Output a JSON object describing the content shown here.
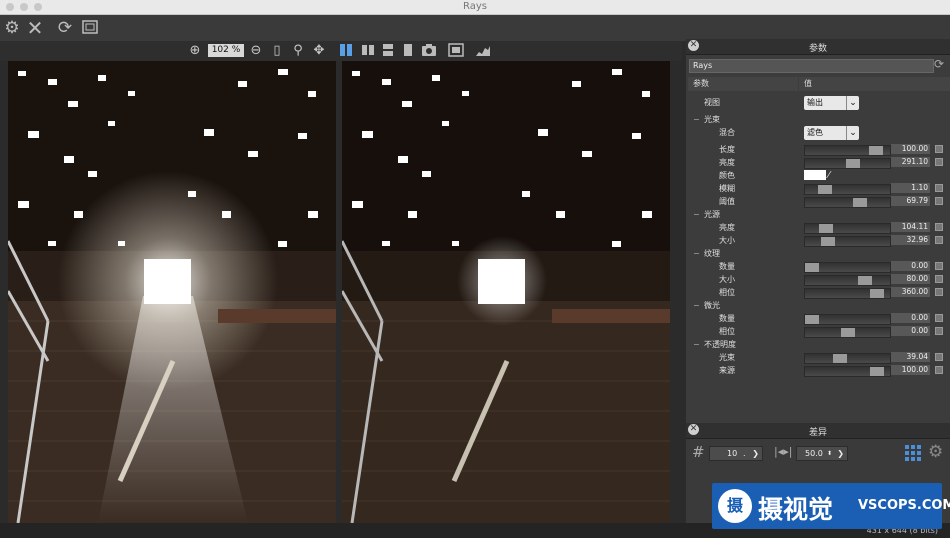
{
  "window": {
    "title": "Rays"
  },
  "toolbar": {
    "icons": [
      "gear-icon",
      "close-icon",
      "refresh-icon",
      "crop-icon"
    ]
  },
  "viewbar": {
    "zoom": "102 %"
  },
  "panel": {
    "title": "参数",
    "preset": "Rays",
    "col_param": "参数",
    "col_value": "值",
    "rows": [
      {
        "label": "视图",
        "level": 1,
        "type": "dropdown",
        "value": "输出"
      },
      {
        "label": "光束",
        "level": 0,
        "type": "group",
        "toggle": "−"
      },
      {
        "label": "混合",
        "level": 2,
        "type": "dropdown",
        "value": "滤色"
      },
      {
        "label": "长度",
        "level": 2,
        "type": "slider",
        "value": "100.00",
        "fraction": 0.9
      },
      {
        "label": "亮度",
        "level": 2,
        "type": "slider",
        "value": "291.10",
        "fraction": 0.58
      },
      {
        "label": "颜色",
        "level": 2,
        "type": "color",
        "value": "#ffffff"
      },
      {
        "label": "模糊",
        "level": 2,
        "type": "slider",
        "value": "1.10",
        "fraction": 0.18
      },
      {
        "label": "阈值",
        "level": 2,
        "type": "slider",
        "value": "69.79",
        "fraction": 0.68
      },
      {
        "label": "光源",
        "level": 0,
        "type": "group",
        "toggle": "−"
      },
      {
        "label": "亮度",
        "level": 2,
        "type": "slider",
        "value": "104.11",
        "fraction": 0.2
      },
      {
        "label": "大小",
        "level": 2,
        "type": "slider",
        "value": "32.96",
        "fraction": 0.22
      },
      {
        "label": "纹理",
        "level": 0,
        "type": "group",
        "toggle": "−"
      },
      {
        "label": "数量",
        "level": 2,
        "type": "slider",
        "value": "0.00",
        "fraction": 0.0
      },
      {
        "label": "大小",
        "level": 2,
        "type": "slider",
        "value": "80.00",
        "fraction": 0.75
      },
      {
        "label": "相位",
        "level": 2,
        "type": "slider",
        "value": "360.00",
        "fraction": 0.92
      },
      {
        "label": "微光",
        "level": 0,
        "type": "group",
        "toggle": "−"
      },
      {
        "label": "数量",
        "level": 2,
        "type": "slider",
        "value": "0.00",
        "fraction": 0.0
      },
      {
        "label": "相位",
        "level": 2,
        "type": "slider",
        "value": "0.00",
        "fraction": 0.5
      },
      {
        "label": "不透明度",
        "level": 0,
        "type": "group",
        "toggle": "−"
      },
      {
        "label": "光束",
        "level": 2,
        "type": "slider",
        "value": "39.04",
        "fraction": 0.39
      },
      {
        "label": "来源",
        "level": 2,
        "type": "slider",
        "value": "100.00",
        "fraction": 0.92
      }
    ]
  },
  "diff": {
    "title": "差异",
    "hash": "#",
    "count": "10",
    "count_unit": ".",
    "value": "50.0"
  },
  "status": {
    "text": "431 x 644 (8 bits)"
  },
  "watermark": {
    "logo": "摄",
    "name": "摄视觉",
    "domain": "VSCOPS.COM"
  }
}
